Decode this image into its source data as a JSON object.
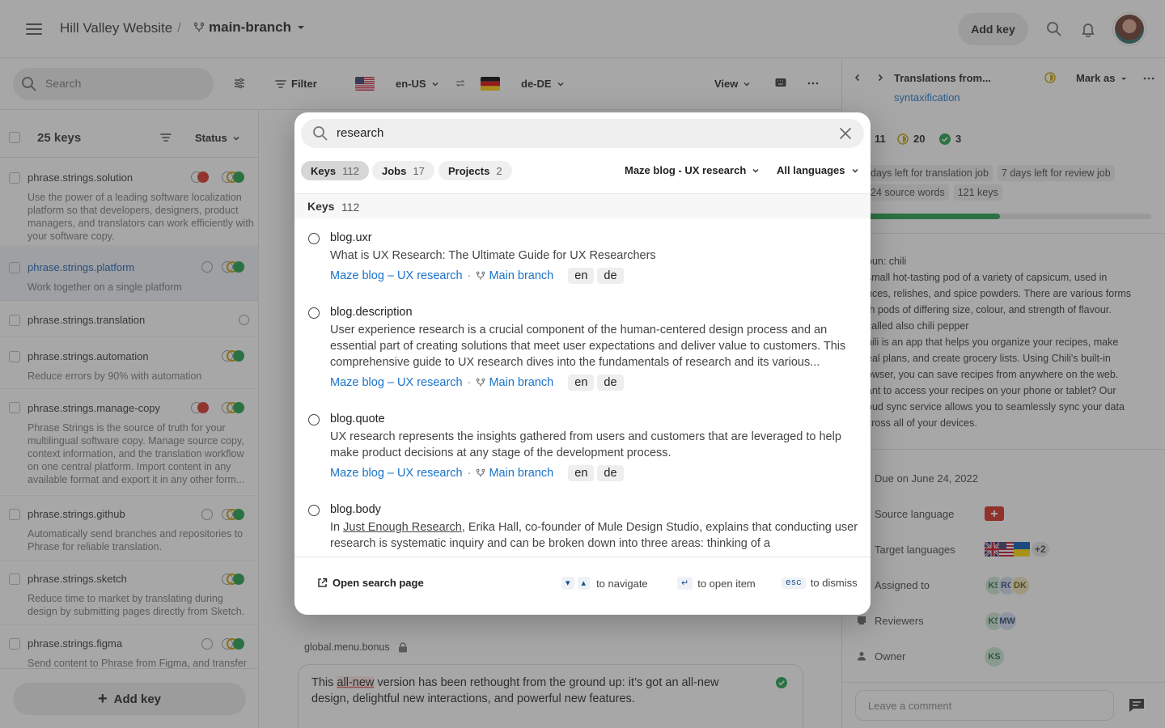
{
  "header": {
    "project": "Hill Valley Website",
    "separator": "/",
    "branch": "main-branch",
    "add_key": "Add key"
  },
  "toolbar": {
    "search_placeholder": "Search",
    "filter": "Filter",
    "source_lang": "en-US",
    "target_lang": "de-DE",
    "view": "View"
  },
  "keylist": {
    "count": "25 keys",
    "status": "Status",
    "add_key": "Add key",
    "items": [
      {
        "name": "phrase.strings.solution",
        "desc": "Use the power of a leading software localization platform so that developers, designers, product managers, and translators can work efficiently with your software copy."
      },
      {
        "name": "phrase.strings.platform",
        "desc": "Work together on a single platform"
      },
      {
        "name": "phrase.strings.translation",
        "desc": ""
      },
      {
        "name": "phrase.strings.automation",
        "desc": "Reduce errors by 90% with automation"
      },
      {
        "name": "phrase.strings.manage-copy",
        "desc": "Phrase Strings is the source of truth for your multilingual software copy. Manage source copy, context information, and the translation workflow on one central platform. Import content in any available format and export it in any other form..."
      },
      {
        "name": "phrase.strings.github",
        "desc": "Automatically send branches and repositories to Phrase for reliable translation."
      },
      {
        "name": "phrase.strings.sketch",
        "desc": "Reduce time to market by translating during design by submitting pages directly from Sketch."
      },
      {
        "name": "phrase.strings.figma",
        "desc": "Send content to Phrase from Figma, and transfer"
      }
    ]
  },
  "editor": {
    "key": "global.menu.bonus",
    "text_before": "This ",
    "text_highlight": "all-new",
    "text_after": " version has been rethought from the ground up: it’s got an all-new design, delightful new interactions, and powerful new features."
  },
  "right_panel": {
    "title": "Translations from...",
    "mark_as": "Mark as",
    "link": "syntaxification",
    "stat1": "11",
    "stat2": "20",
    "stat3": "3",
    "chips": [
      "days left for translation job",
      "7 days left for review job",
      "24 source words",
      "121 keys"
    ],
    "progress": 0.47,
    "definition": [
      "oun: chili",
      "small hot-tasting pod of a variety of capsicum, used in",
      "uces, relishes, and spice powders. There are various forms",
      "th pods of differing size, colour, and strength of flavour.",
      "called also chili pepper",
      "hili is an app that helps you organize your recipes, make",
      "eal plans, and create grocery lists. Using Chili's built-in",
      "owser, you can save recipes from anywhere on the web.",
      "ant to access your recipes on your phone or tablet? Our",
      "oud sync service allows you to seamlessly sync your data",
      "cross all of your devices."
    ],
    "due": "Due on June 24, 2022",
    "source_language": "Source language",
    "target_languages": "Target languages",
    "target_more": "+2",
    "assigned_to": "Assigned to",
    "assignees": [
      "KS",
      "RC",
      "DK"
    ],
    "reviewers": "Reviewers",
    "reviewer_list": [
      "KS",
      "MW"
    ],
    "owner": "Owner",
    "owner_initials": "KS",
    "comment_placeholder": "Leave a comment"
  },
  "search_modal": {
    "query": "research",
    "tabs": [
      {
        "label": "Keys",
        "count": "112"
      },
      {
        "label": "Jobs",
        "count": "17"
      },
      {
        "label": "Projects",
        "count": "2"
      }
    ],
    "project_filter": "Maze blog - UX research",
    "language_filter": "All languages",
    "section_title": "Keys",
    "section_count": "112",
    "results": [
      {
        "key": "blog.uxr",
        "desc": "What is UX Research: The Ultimate Guide for UX Researchers",
        "project": "Maze blog – UX research",
        "branch": "Main branch",
        "langs": [
          "en",
          "de"
        ]
      },
      {
        "key": "blog.description",
        "desc": "User experience research is a crucial component of the human-centered design process and an essential part of creating solutions that meet user expectations and deliver value to customers. This comprehensive guide to UX research dives into the fundamentals of research and its various...",
        "project": "Maze blog – UX research",
        "branch": "Main branch",
        "langs": [
          "en",
          "de"
        ]
      },
      {
        "key": "blog.quote",
        "desc": "UX research represents the insights gathered from users and customers that are leveraged to help make product decisions at any stage of the development process.",
        "project": "Maze blog – UX research",
        "branch": "Main branch",
        "langs": [
          "en",
          "de"
        ]
      },
      {
        "key": "blog.body",
        "desc_prefix": "In ",
        "desc_link": "Just Enough Research",
        "desc_rest": ", Erika Hall, co-founder of Mule Design Studio, explains that conducting user research is systematic inquiry and can be broken down into three areas: thinking of a"
      }
    ],
    "footer": {
      "open_search": "Open search page",
      "navigate": "to navigate",
      "open_item": "to open item",
      "esc": "esc",
      "dismiss": "to dismiss"
    }
  }
}
